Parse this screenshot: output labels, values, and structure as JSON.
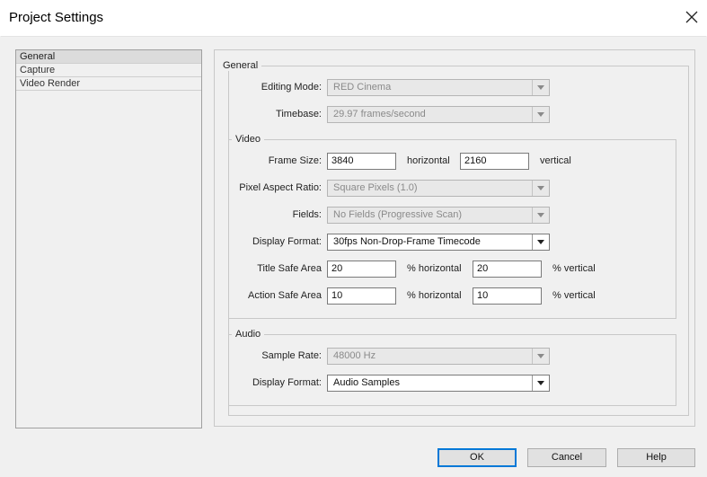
{
  "window": {
    "title": "Project Settings"
  },
  "categories": [
    {
      "label": "General"
    },
    {
      "label": "Capture"
    },
    {
      "label": "Video Render"
    }
  ],
  "general": {
    "group_title": "General",
    "editing_mode_label": "Editing Mode:",
    "editing_mode_value": "RED Cinema",
    "timebase_label": "Timebase:",
    "timebase_value": "29.97 frames/second"
  },
  "video": {
    "group_title": "Video",
    "frame_size_label": "Frame Size:",
    "frame_width": "3840",
    "horizontal_label": "horizontal",
    "frame_height": "2160",
    "vertical_label": "vertical",
    "pixel_aspect_label": "Pixel Aspect Ratio:",
    "pixel_aspect_value": "Square Pixels (1.0)",
    "fields_label": "Fields:",
    "fields_value": "No Fields (Progressive Scan)",
    "display_format_label": "Display Format:",
    "display_format_value": "30fps Non-Drop-Frame Timecode",
    "title_safe_label": "Title Safe Area",
    "title_safe_h": "20",
    "title_safe_h_unit": "% horizontal",
    "title_safe_v": "20",
    "title_safe_v_unit": "% vertical",
    "action_safe_label": "Action Safe Area",
    "action_safe_h": "10",
    "action_safe_h_unit": "% horizontal",
    "action_safe_v": "10",
    "action_safe_v_unit": "% vertical"
  },
  "audio": {
    "group_title": "Audio",
    "sample_rate_label": "Sample Rate:",
    "sample_rate_value": "48000 Hz",
    "display_format_label": "Display Format:",
    "display_format_value": "Audio Samples"
  },
  "buttons": {
    "ok": "OK",
    "cancel": "Cancel",
    "help": "Help"
  },
  "colors": {
    "default_button_border": "#0078d7",
    "disabled_text": "#8a8a8a"
  }
}
